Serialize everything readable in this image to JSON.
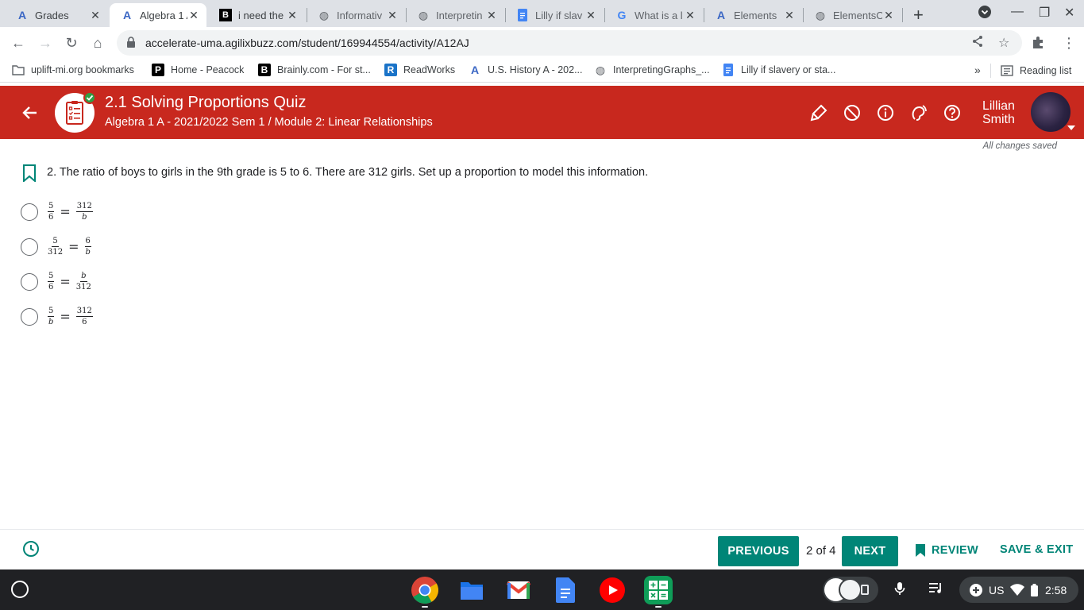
{
  "browser": {
    "tabs": [
      {
        "title": "Grades",
        "icon": "agilix-icon"
      },
      {
        "title": "Algebra 1 A",
        "icon": "agilix-icon"
      },
      {
        "title": "i need the",
        "icon": "brainly-icon"
      },
      {
        "title": "Informativ",
        "icon": "globe-icon"
      },
      {
        "title": "Interpretin",
        "icon": "globe-icon"
      },
      {
        "title": "Lilly if slav",
        "icon": "docs-icon"
      },
      {
        "title": "What is a l",
        "icon": "google-icon"
      },
      {
        "title": "Elements",
        "icon": "agilix-icon"
      },
      {
        "title": "ElementsO",
        "icon": "globe-icon"
      }
    ],
    "url": "accelerate-uma.agilixbuzz.com/student/169944554/activity/A12AJ",
    "bookmarks": [
      {
        "label": "uplift-mi.org bookmarks",
        "icon": "folder-icon"
      },
      {
        "label": "Home - Peacock",
        "icon": "peacock-icon"
      },
      {
        "label": "Brainly.com - For st...",
        "icon": "brainly-icon"
      },
      {
        "label": "ReadWorks",
        "icon": "readworks-icon"
      },
      {
        "label": "U.S. History A - 202...",
        "icon": "agilix-icon"
      },
      {
        "label": "InterpretingGraphs_...",
        "icon": "globe-icon"
      },
      {
        "label": "Lilly if slavery or sta...",
        "icon": "docs-icon"
      }
    ],
    "more_bookmarks": "»",
    "reading_list": "Reading list"
  },
  "header": {
    "title": "2.1 Solving Proportions Quiz",
    "breadcrumb": "Algebra 1 A - 2021/2022 Sem 1 / Module 2: Linear Relationships",
    "user_first": "Lillian",
    "user_last": "Smith",
    "accent": "#c8281e"
  },
  "status": {
    "saved": "All changes saved"
  },
  "question": {
    "text": "2. The ratio of boys to girls in the 9th grade is 5 to 6. There are 312 girls. Set up a proportion to model this information.",
    "options": [
      {
        "a_num": "5",
        "a_den": "6",
        "b_num": "312",
        "b_den": "b"
      },
      {
        "a_num": "5",
        "a_den": "312",
        "b_num": "6",
        "b_den": "b"
      },
      {
        "a_num": "5",
        "a_den": "6",
        "b_num": "b",
        "b_den": "312"
      },
      {
        "a_num": "5",
        "a_den": "b",
        "b_num": "312",
        "b_den": "6"
      }
    ]
  },
  "footer": {
    "previous": "PREVIOUS",
    "pager": "2 of 4",
    "next": "NEXT",
    "review": "REVIEW",
    "save_exit": "SAVE & EXIT",
    "accent": "#008577"
  },
  "system": {
    "locale": "US",
    "time": "2:58"
  }
}
